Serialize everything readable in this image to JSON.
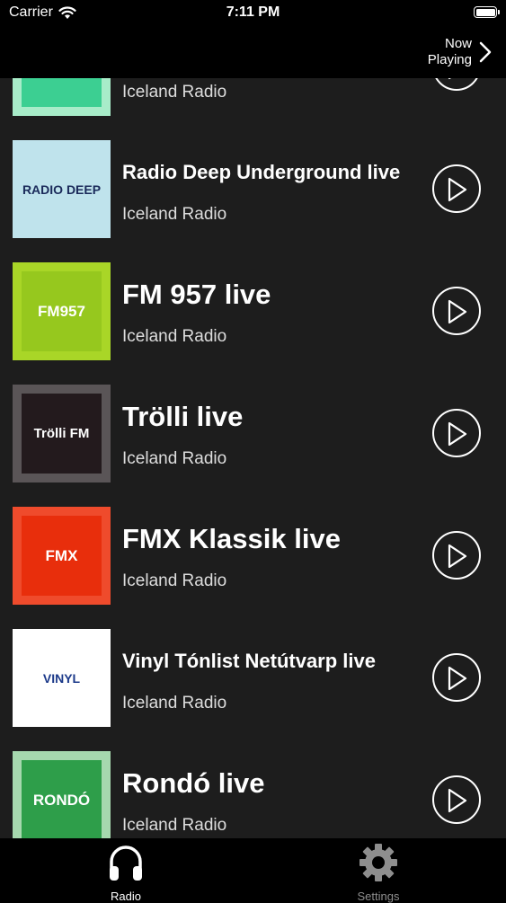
{
  "status": {
    "carrier": "Carrier",
    "time": "7:11 PM"
  },
  "nav": {
    "now_playing_line1": "Now",
    "now_playing_line2": "Playing"
  },
  "stations": [
    {
      "name": "",
      "subtitle": "Iceland Radio",
      "art_label": "",
      "art_outer": "#a8ecc9",
      "art_inner": "#3ccf92"
    },
    {
      "name": "Radio Deep Underground live",
      "subtitle": "Iceland Radio",
      "art_label": "RADIO DEEP",
      "art_outer": "#bfe3ec",
      "art_inner": "#bfe3ec"
    },
    {
      "name": "FM 957 live",
      "subtitle": "Iceland Radio",
      "art_label": "FM957",
      "art_outer": "#a9d627",
      "art_inner": "#96c81e"
    },
    {
      "name": "Trölli live",
      "subtitle": "Iceland Radio",
      "art_label": "Trölli FM",
      "art_outer": "#5a5557",
      "art_inner": "#231a1d"
    },
    {
      "name": "FMX Klassik live",
      "subtitle": "Iceland Radio",
      "art_label": "FMX",
      "art_outer": "#ef4b2c",
      "art_inner": "#e82e0c"
    },
    {
      "name": "Vinyl Tónlist Netútvarp live",
      "subtitle": "Iceland Radio",
      "art_label": "VINYL",
      "art_outer": "#ffffff",
      "art_inner": "#ffffff"
    },
    {
      "name": "Rondó live",
      "subtitle": "Iceland Radio",
      "art_label": "RONDÓ",
      "art_outer": "#a6d8ae",
      "art_inner": "#2e9e4a"
    }
  ],
  "tabs": {
    "radio": "Radio",
    "settings": "Settings"
  }
}
